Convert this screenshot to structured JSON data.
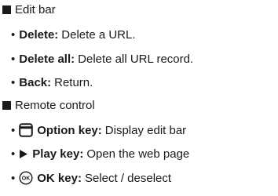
{
  "edit_bar": {
    "heading": "Edit bar",
    "items": [
      {
        "term": "Delete:",
        "desc": "Delete a URL."
      },
      {
        "term": "Delete all:",
        "desc": "Delete all URL record."
      },
      {
        "term": "Back:",
        "desc": "Return."
      }
    ]
  },
  "remote_control": {
    "heading": "Remote control",
    "items": [
      {
        "icon": "option-key-icon",
        "term": "Option key:",
        "desc": "Display edit bar"
      },
      {
        "icon": "play-icon",
        "term": "Play key:",
        "desc": "Open the web page"
      },
      {
        "icon": "ok-key-icon",
        "icon_text": "OK",
        "term": "OK key:",
        "desc": "Select / deselect"
      }
    ]
  }
}
